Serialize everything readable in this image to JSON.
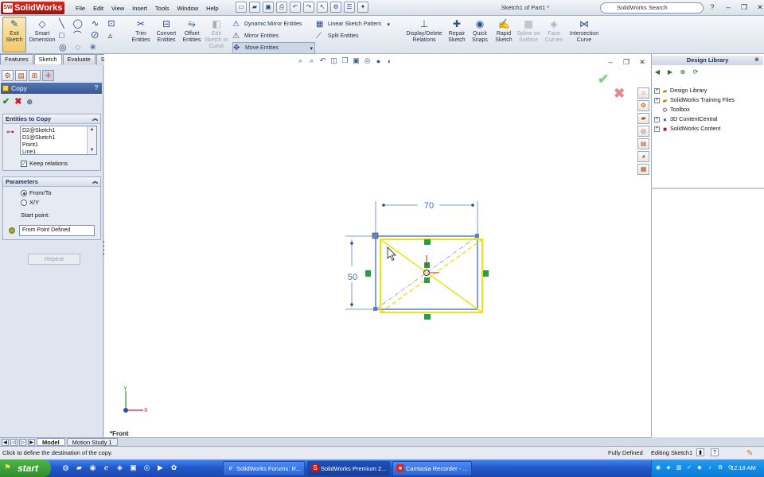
{
  "app": {
    "brand": "SolidWorks",
    "logo_mark": "SW",
    "document_title": "Sketch1 of Part1 *"
  },
  "menu": [
    "File",
    "Edit",
    "View",
    "Insert",
    "Tools",
    "Window",
    "Help"
  ],
  "search": {
    "placeholder": "SolidWorks Search"
  },
  "ribbon": {
    "exit_sketch": "Exit Sketch",
    "smart_dimension": "Smart Dimension",
    "trim": "Trim Entities",
    "convert": "Convert Entities",
    "offset": "Offset Entities",
    "edit_sketch": "Edit Sketch or Curve",
    "dynamic_mirror": "Dynamic Mirror Entities",
    "mirror": "Mirror Entities",
    "move": "Move Entities",
    "linear_pattern": "Linear Sketch Pattern",
    "split": "Split Entities",
    "display_delete": "Display/Delete Relations",
    "repair": "Repair Sketch",
    "quick_snaps": "Quick Snaps",
    "rapid": "Rapid Sketch",
    "spline_surface": "Spline on Surface",
    "face_curves": "Face Curves",
    "intersection": "Intersection Curve"
  },
  "tabs": [
    "Features",
    "Sketch",
    "Evaluate",
    "Surfaces"
  ],
  "property_manager": {
    "title": "Copy",
    "help": "?",
    "entities_section": "Entities to Copy",
    "entities": [
      "D2@Sketch1",
      "D1@Sketch1",
      "Point1",
      "Line1"
    ],
    "keep_relations": "Keep relations",
    "parameters_section": "Parameters",
    "from_to": "From/To",
    "xy": "X/Y",
    "start_point_label": "Start point:",
    "start_point_value": "From Point Defined",
    "repeat": "Repeat"
  },
  "sketch": {
    "width_dim": "70",
    "height_dim": "50",
    "view_label": "*Front"
  },
  "design_library": {
    "title": "Design Library",
    "items": [
      "Design Library",
      "SolidWorks Training Files",
      "Toolbox",
      "3D ContentCentral",
      "SolidWorks Content"
    ]
  },
  "bottom_tabs": [
    "Model",
    "Motion Study 1"
  ],
  "status": {
    "message": "Click to define the destination of the copy.",
    "defined": "Fully Defined",
    "editing": "Editing Sketch1"
  },
  "taskbar": {
    "start": "start",
    "windows": [
      "SolidWorks Forums: R...",
      "SolidWorks Premium 2...",
      "Camtasia Recorder - ..."
    ],
    "clock": "12:18 AM"
  },
  "colors": {
    "accent": "#3a5894",
    "sketch_selected": "#f0e020",
    "sketch_line": "#2a5fd0",
    "relation": "#1fa33a"
  }
}
